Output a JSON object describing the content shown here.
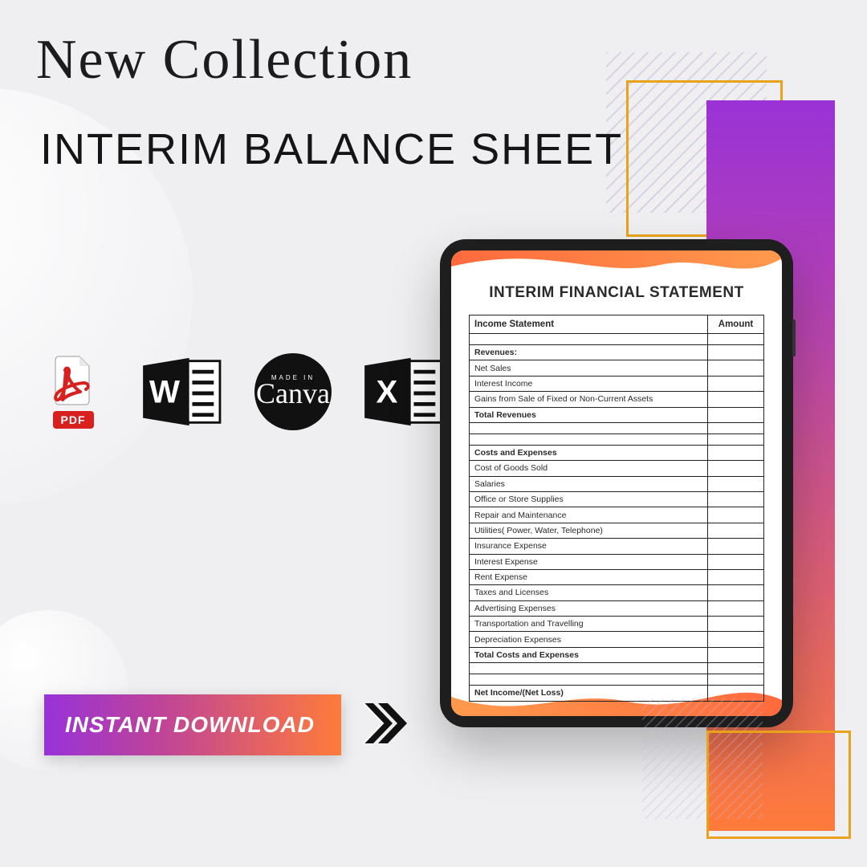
{
  "header": {
    "collection_script": "New Collection",
    "title": "INTERIM BALANCE SHEET"
  },
  "icons": {
    "pdf_label": "PDF",
    "canva_made": "MADE IN",
    "canva_brand": "Canva"
  },
  "download": {
    "label": "INSTANT DOWNLOAD"
  },
  "document": {
    "title": "INTERIM FINANCIAL STATEMENT",
    "header_left": "Income Statement",
    "header_right": "Amount",
    "sections": {
      "revenues_label": "Revenues:",
      "revenues": [
        "Net Sales",
        "Interest Income",
        "Gains from Sale of Fixed or Non-Current Assets"
      ],
      "revenues_total": "Total Revenues",
      "costs_label": "Costs and Expenses",
      "costs": [
        "Cost of Goods Sold",
        "Salaries",
        "Office or Store Supplies",
        "Repair and Maintenance",
        "Utilities( Power, Water, Telephone)",
        "Insurance Expense",
        "Interest Expense",
        "Rent Expense",
        "Taxes and Licenses",
        "Advertising Expenses",
        "Transportation and Travelling",
        "Depreciation Expenses"
      ],
      "costs_total": "Total Costs and Expenses",
      "net": "Net Income/(Net Loss)"
    }
  }
}
